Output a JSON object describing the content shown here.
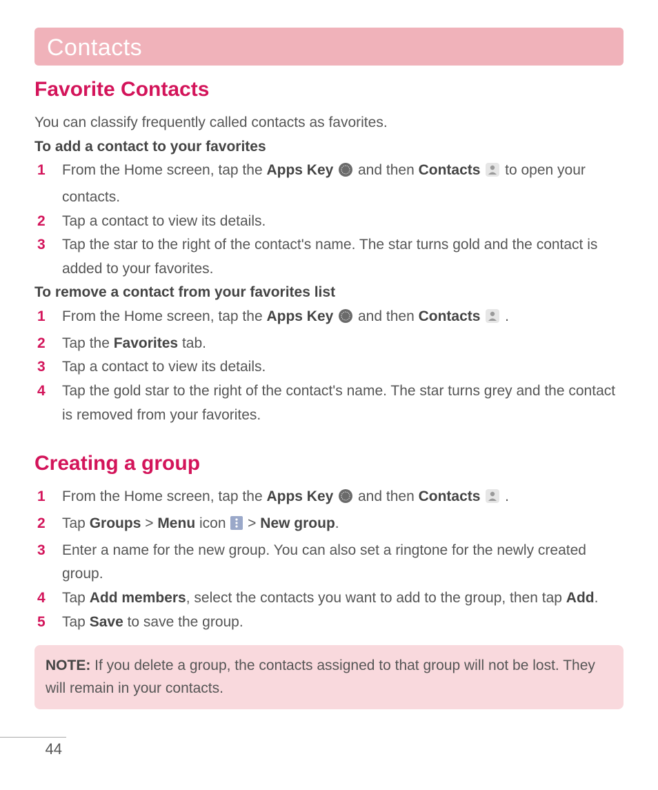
{
  "page_number": "44",
  "chapter_title": "Contacts",
  "section1": {
    "heading": "Favorite Contacts",
    "intro": "You can classify frequently called contacts as favorites.",
    "sub1": "To add a contact to your favorites",
    "add_steps": {
      "s1a": "From the Home screen, tap the ",
      "s1_apps": "Apps Key",
      "s1b": " and then ",
      "s1_contacts": "Contacts",
      "s1c": " to open your contacts.",
      "s2": "Tap a contact to view its details.",
      "s3": "Tap the star to the right of the contact's name. The star turns gold and the contact is added to your favorites."
    },
    "sub2": "To remove a contact from your favorites list",
    "rem_steps": {
      "s1a": "From the Home screen, tap the ",
      "s1_apps": "Apps Key",
      "s1b": " and then ",
      "s1_contacts": "Contacts",
      "s1c": " .",
      "s2a": "Tap the ",
      "s2_fav": "Favorites",
      "s2b": " tab.",
      "s3": "Tap a contact to view its details.",
      "s4": "Tap the gold star to the right of the contact's name. The star turns grey and the contact is removed from your favorites."
    }
  },
  "section2": {
    "heading": "Creating a group",
    "steps": {
      "s1a": "From the Home screen, tap the ",
      "s1_apps": "Apps Key",
      "s1b": " and then ",
      "s1_contacts": "Contacts",
      "s1c": " .",
      "s2a": "Tap ",
      "s2_groups": "Groups",
      "s2b": " > ",
      "s2_menu": "Menu",
      "s2c": " icon ",
      "s2d": " > ",
      "s2_new": "New group",
      "s2e": ".",
      "s3": "Enter a name for the new group. You can also set a ringtone for the newly created group.",
      "s4a": "Tap ",
      "s4_addm": "Add members",
      "s4b": ", select the contacts you want to add to the group, then tap ",
      "s4_add": "Add",
      "s4c": ".",
      "s5a": "Tap ",
      "s5_save": "Save",
      "s5b": " to save the group."
    },
    "note_label": "NOTE:",
    "note_text": " If you delete a group, the contacts assigned to that group will not be lost. They will remain in your contacts."
  }
}
